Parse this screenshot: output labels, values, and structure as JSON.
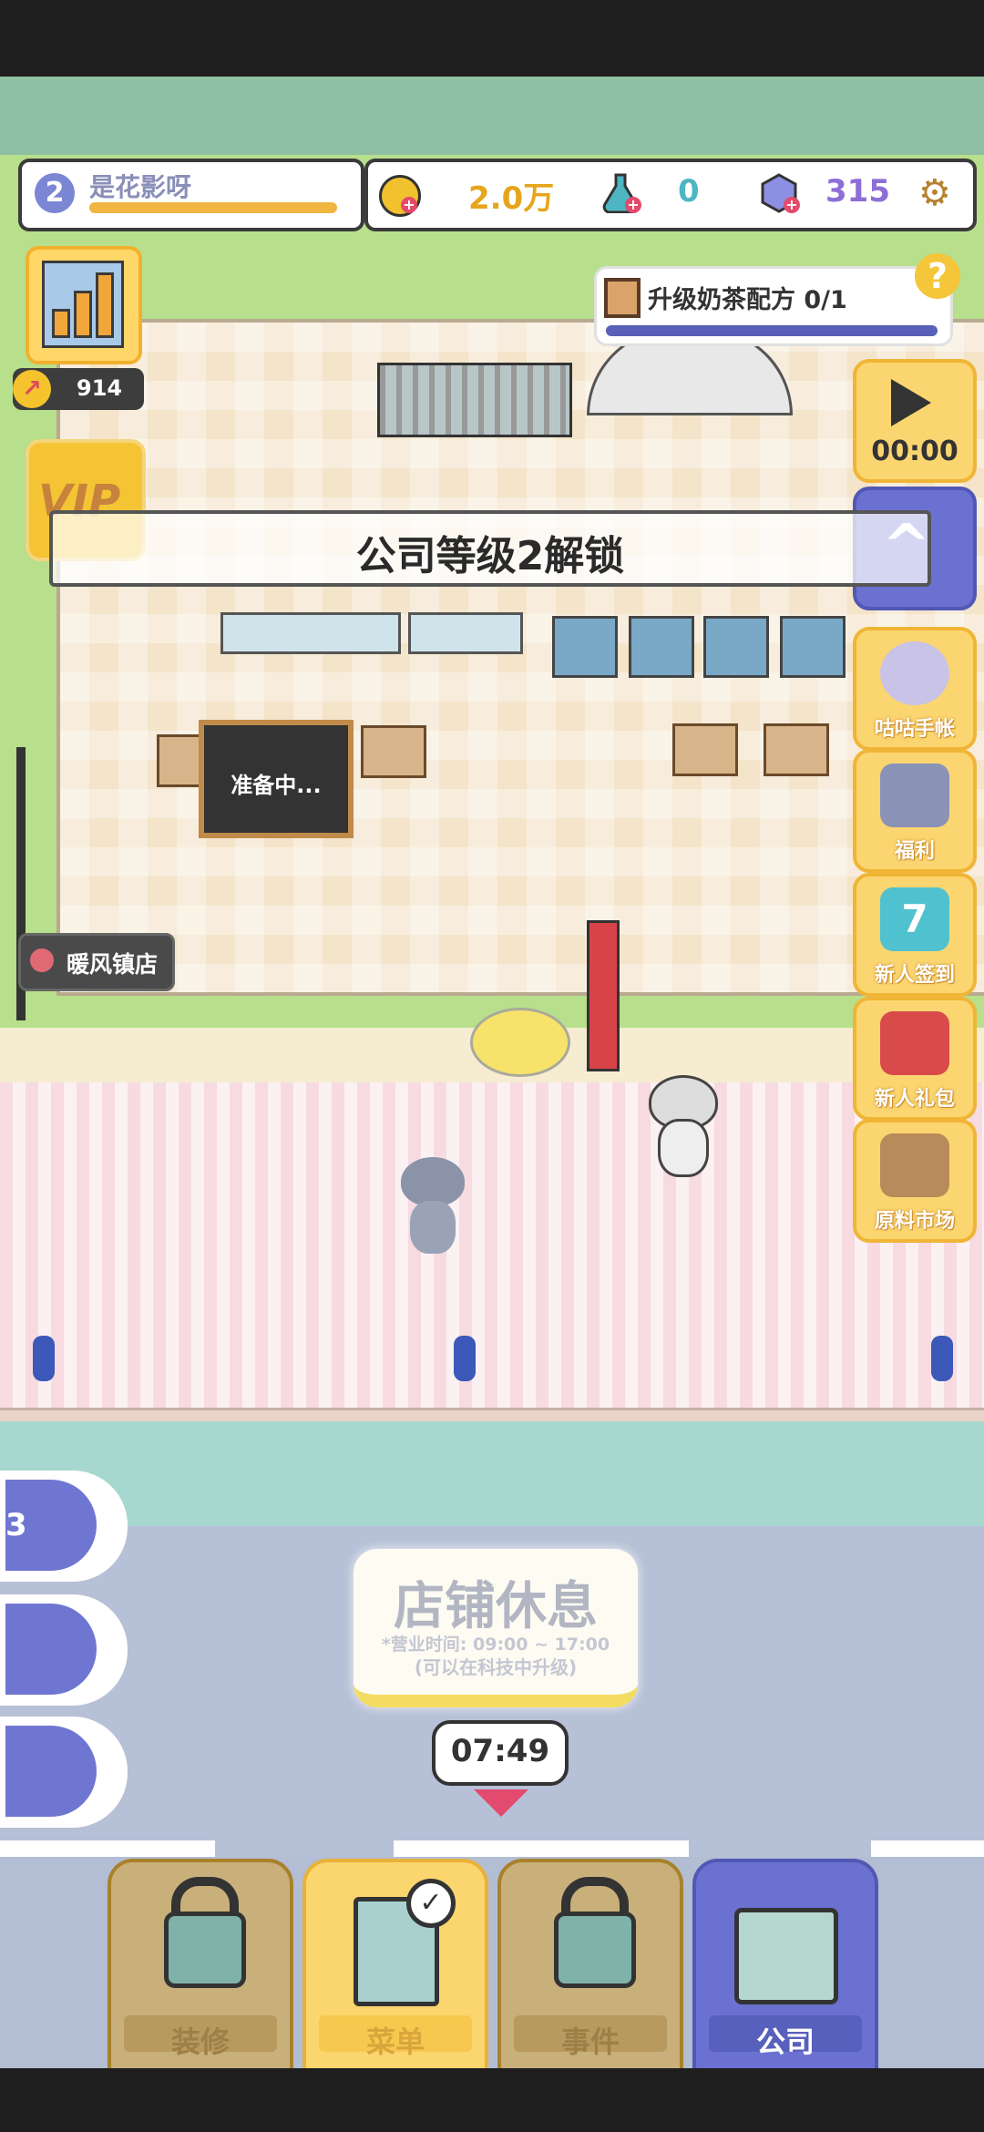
{
  "player": {
    "level": "2",
    "name": "是花影呀"
  },
  "resources": {
    "coins": "2.0万",
    "potion": "0",
    "gems": "315"
  },
  "trend_value": "914",
  "vip_label": "VIP",
  "unlock_banner": "公司等级2解锁",
  "quest": {
    "text": "升级奶茶配方 0/1",
    "help": "?"
  },
  "ad_timer": "00:00",
  "right_menu": [
    {
      "label": "咕咕手帐",
      "icon": "ghost-cat-icon"
    },
    {
      "label": "福利",
      "icon": "cat-red-envelope-icon"
    },
    {
      "label": "新人签到",
      "icon": "calendar-icon",
      "badge": "7"
    },
    {
      "label": "新人礼包",
      "icon": "gift-icon"
    },
    {
      "label": "原料市场",
      "icon": "market-box-icon"
    }
  ],
  "store_name": "暖风镇店",
  "board_text": "准备中...",
  "rest_panel": {
    "title": "店铺休息",
    "hours": "*营业时间: 09:00 ~ 17:00",
    "hint": "(可以在科技中升级)"
  },
  "clock": "07:49",
  "left_tools": [
    {
      "name": "search",
      "count": "3"
    },
    {
      "name": "cup"
    },
    {
      "name": "display"
    }
  ],
  "tabs": [
    {
      "label": "装修",
      "locked": true
    },
    {
      "label": "菜单",
      "locked": false
    },
    {
      "label": "事件",
      "locked": true
    },
    {
      "label": "公司",
      "locked": false,
      "active": true
    }
  ],
  "colors": {
    "accent": "#6a71d0",
    "gold": "#fbd570",
    "rest_bar": "#f4dc62",
    "clock_arrow": "#e24a6e"
  }
}
